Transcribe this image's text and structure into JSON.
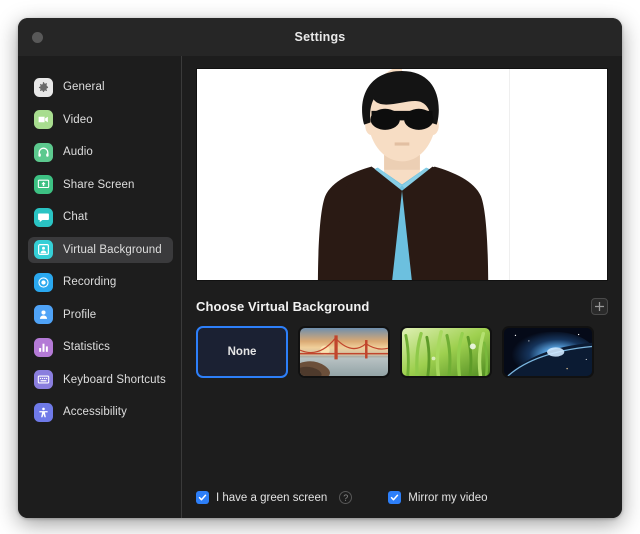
{
  "window": {
    "title": "Settings",
    "close_button": "close"
  },
  "sidebar": {
    "items": [
      {
        "label": "General",
        "icon": "gear-icon",
        "color": "#e8e8e8",
        "selected": false
      },
      {
        "label": "Video",
        "icon": "video-camera-icon",
        "color": "#a8dd8f",
        "selected": false
      },
      {
        "label": "Audio",
        "icon": "headphones-icon",
        "color": "#5cc98e",
        "selected": false
      },
      {
        "label": "Share Screen",
        "icon": "share-screen-icon",
        "color": "#3dc183",
        "selected": false
      },
      {
        "label": "Chat",
        "icon": "chat-bubble-icon",
        "color": "#2ac3c3",
        "selected": false
      },
      {
        "label": "Virtual Background",
        "icon": "virtual-background-icon",
        "color": "#35cfd6",
        "selected": true
      },
      {
        "label": "Recording",
        "icon": "record-icon",
        "color": "#2aa8ef",
        "selected": false
      },
      {
        "label": "Profile",
        "icon": "profile-person-icon",
        "color": "#4fa3f7",
        "selected": false
      },
      {
        "label": "Statistics",
        "icon": "bar-chart-icon",
        "color": "#b47ad6",
        "selected": false
      },
      {
        "label": "Keyboard Shortcuts",
        "icon": "keyboard-icon",
        "color": "#8a7ede",
        "selected": false
      },
      {
        "label": "Accessibility",
        "icon": "accessibility-icon",
        "color": "#6f7ae8",
        "selected": false
      }
    ]
  },
  "main": {
    "preview": {
      "description": "video-self-preview",
      "background_color": "#ffffff",
      "skin_color": "#f7ddc4",
      "hair_color": "#141414",
      "jacket_color": "#2a1a14",
      "shirt_color": "#6cc0df",
      "sunglasses_color": "#0d0d0d"
    },
    "section_title": "Choose Virtual Background",
    "add_button_label": "+",
    "backgrounds": [
      {
        "label": "None",
        "type": "none",
        "selected": true
      },
      {
        "label": "Golden Gate Bridge",
        "type": "bridge",
        "selected": false
      },
      {
        "label": "Grass",
        "type": "grass",
        "selected": false
      },
      {
        "label": "Earth from Space",
        "type": "space",
        "selected": false
      }
    ],
    "options": [
      {
        "label": "I have a green screen",
        "checked": true,
        "has_help": true
      },
      {
        "label": "Mirror my video",
        "checked": true,
        "has_help": false
      }
    ],
    "help_glyph": "?",
    "check_glyph": "✓"
  },
  "colors": {
    "accent": "#2d7ff9",
    "window_bg": "#1d1d1d",
    "titlebar_bg": "#262626",
    "selected_nav_bg": "#3a3a3c"
  }
}
